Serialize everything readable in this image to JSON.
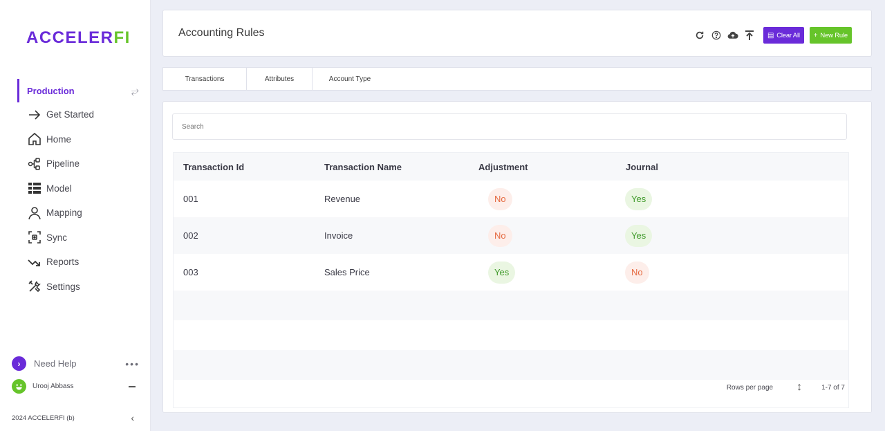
{
  "brand": {
    "name_main": "ACCELER",
    "name_accent": "FI"
  },
  "environment": {
    "label": "Production"
  },
  "nav": [
    {
      "label": "Get Started",
      "icon": "arrow-right-icon"
    },
    {
      "label": "Home",
      "icon": "home-icon"
    },
    {
      "label": "Pipeline",
      "icon": "pipeline-icon"
    },
    {
      "label": "Model",
      "icon": "model-icon"
    },
    {
      "label": "Mapping",
      "icon": "user-icon"
    },
    {
      "label": "Sync",
      "icon": "sync-icon"
    },
    {
      "label": "Reports",
      "icon": "reports-icon"
    },
    {
      "label": "Settings",
      "icon": "settings-icon"
    }
  ],
  "help": {
    "label": "Need Help"
  },
  "user": {
    "name": "Urooj Abbass"
  },
  "footer": {
    "text": "2024 ACCELERFI (b)"
  },
  "header": {
    "title": "Accounting Rules",
    "clear_label": "Clear All",
    "new_label": "New Rule"
  },
  "tabs": [
    "Transactions",
    "Attributes",
    "Account Type"
  ],
  "search": {
    "placeholder": "Search"
  },
  "table": {
    "columns": [
      "Transaction Id",
      "Transaction Name",
      "Adjustment",
      "Journal"
    ],
    "rows": [
      {
        "id": "001",
        "name": "Revenue",
        "adjustment": "No",
        "journal": "Yes"
      },
      {
        "id": "002",
        "name": "Invoice",
        "adjustment": "No",
        "journal": "Yes"
      },
      {
        "id": "003",
        "name": "Sales Price",
        "adjustment": "Yes",
        "journal": "No"
      }
    ]
  },
  "pager": {
    "rows_per_page_label": "Rows per page",
    "range": "1-7 of 7"
  },
  "colors": {
    "accent": "#6a2bd9",
    "brand_green": "#66c42a",
    "no": "#e5693f",
    "yes": "#3f9a2a"
  }
}
